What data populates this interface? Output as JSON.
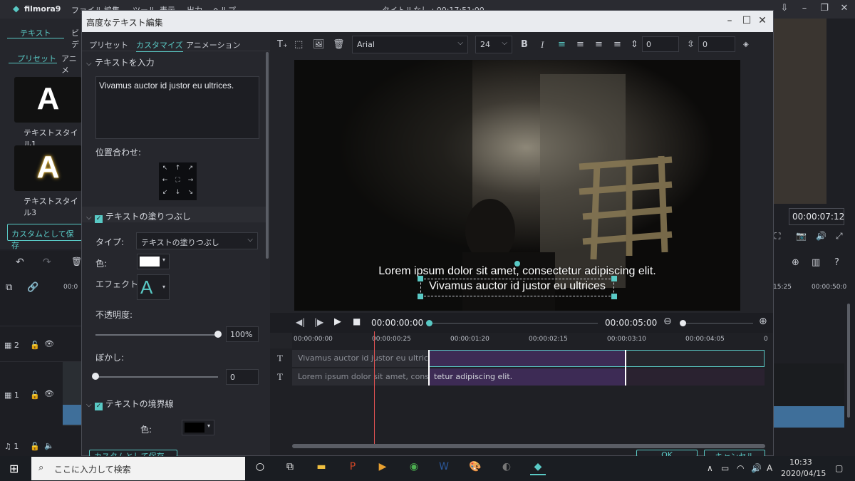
{
  "app": {
    "logo": "filmora9",
    "menu": [
      "ファイル",
      "編集",
      "ツール",
      "表示",
      "出力",
      "ヘルプ"
    ],
    "title": "タイトルなし : 00:17:51:00",
    "left_tabs": [
      "テキスト",
      "ビデ"
    ],
    "left_subtabs": [
      "プリセット",
      "アニメ"
    ],
    "tile_letter": "A",
    "tile_labels": [
      "テキストスタイル1",
      "テキストスタイル3"
    ],
    "save_custom": "カスタムとして保存",
    "timecode_right": "00:00:07:12",
    "ruler_right": [
      "15:25",
      "00:00:50:0"
    ],
    "ruler_left": "00:0",
    "track_labels": [
      "2",
      "1",
      "1"
    ]
  },
  "dialog": {
    "title": "高度なテキスト編集",
    "tabs": [
      "プリセット",
      "カスタマイズ",
      "アニメーション"
    ],
    "text_section": "テキストを入力",
    "text_value": "Vivamus auctor id justor eu ultrices.",
    "alignment_label": "位置合わせ:",
    "fill_section": "テキストの塗りつぶし",
    "type_label": "タイプ:",
    "type_value": "テキストの塗りつぶし",
    "color_label": "色:",
    "effect_label": "エフェクト:",
    "effect_letter": "A",
    "opacity_label": "不透明度:",
    "opacity_value": "100%",
    "opacity_level": 1.0,
    "blur_label": "ぼかし:",
    "blur_value": "0",
    "blur_level": 0.0,
    "border_section": "テキストの境界線",
    "border_color_label": "色:",
    "bottom_left_button": "カスタムとして保存",
    "ok_button": "OK",
    "cancel_button": "キャンセル",
    "font_name": "Arial",
    "font_size": "24",
    "spacing_1": "0",
    "spacing_2": "0",
    "preview_line1": "Lorem ipsum dolor sit amet, consectetur adipiscing elit.",
    "preview_line2": "Vivamus auctor id justor eu ultrices",
    "play_time": "00:00:00:00",
    "duration": "00:00:05:00",
    "ruler_labels": [
      "00:00:00:00",
      "00:00:00:25",
      "00:00:01:20",
      "00:00:02:15",
      "00:00:03:10",
      "00:00:04:05",
      "0"
    ],
    "clip1": "Vivamus auctor id justor eu ultrices.",
    "clip2a": "Lorem ipsum dolor sit amet, consec",
    "clip2b": "tetur adipiscing elit.",
    "track_letter": "T"
  },
  "taskbar": {
    "search_placeholder": "ここに入力して検索",
    "time": "10:33",
    "date": "2020/04/15",
    "ime": "A"
  },
  "colors": {
    "accent": "#59c9c5",
    "fill_color": "#ffffff",
    "border_color": "#000000",
    "clip_purple": "#3d2b55"
  }
}
